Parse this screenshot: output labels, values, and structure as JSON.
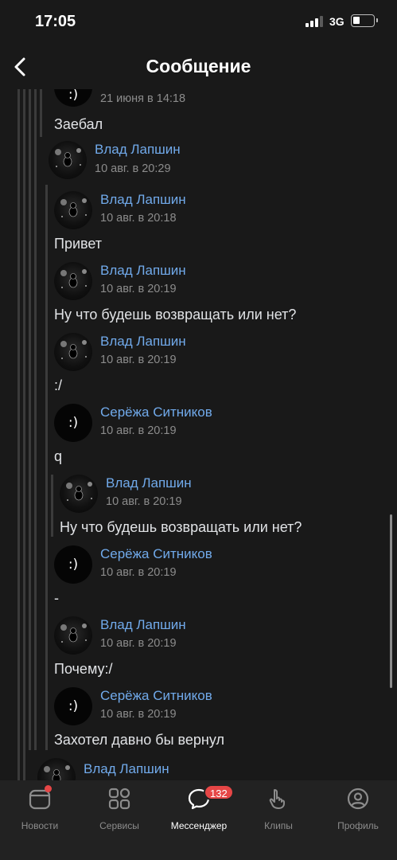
{
  "status_bar": {
    "time": "17:05",
    "network": "3G"
  },
  "header": {
    "title": "Сообщение"
  },
  "messages": [
    {
      "author": "",
      "time": "21 июня в 14:18",
      "text": "Заебал",
      "avatar": "smile-avatar"
    },
    {
      "author": "Влад Лапшин",
      "time": "10 авг. в 20:29",
      "text": "",
      "avatar": "space-avatar"
    },
    {
      "author": "Влад Лапшин",
      "time": "10 авг. в 20:18",
      "text": "Привет",
      "avatar": "space-avatar"
    },
    {
      "author": "Влад Лапшин",
      "time": "10 авг. в 20:19",
      "text": "Ну что будешь возвращать или нет?",
      "avatar": "space-avatar"
    },
    {
      "author": "Влад Лапшин",
      "time": "10 авг. в 20:19",
      "text": ":/",
      "avatar": "space-avatar"
    },
    {
      "author": "Серёжа Ситников",
      "time": "10 авг. в 20:19",
      "text": "q",
      "avatar": "smile-avatar",
      "avatar_text": ":)"
    },
    {
      "author": "Влад Лапшин",
      "time": "10 авг. в 20:19",
      "text": "Ну что будешь возвращать или нет?",
      "avatar": "space-avatar"
    },
    {
      "author": "Серёжа Ситников",
      "time": "10 авг. в 20:19",
      "text": "-",
      "avatar": "smile-avatar",
      "avatar_text": ":)"
    },
    {
      "author": "Влад Лапшин",
      "time": "10 авг. в 20:19",
      "text": "Почему:/",
      "avatar": "space-avatar"
    },
    {
      "author": "Серёжа Ситников",
      "time": "10 авг. в 20:19",
      "text": "Захотел давно бы вернул",
      "avatar": "smile-avatar",
      "avatar_text": ":)"
    },
    {
      "author": "Влад Лапшин",
      "time": "",
      "text": "",
      "avatar": "space-avatar"
    }
  ],
  "tabbar": {
    "tabs": [
      {
        "label": "Новости",
        "icon": "news-icon"
      },
      {
        "label": "Сервисы",
        "icon": "services-icon"
      },
      {
        "label": "Мессенджер",
        "icon": "messenger-icon",
        "badge": "132",
        "active": true
      },
      {
        "label": "Клипы",
        "icon": "clips-icon"
      },
      {
        "label": "Профиль",
        "icon": "profile-icon"
      }
    ]
  },
  "colors": {
    "background": "#191919",
    "link": "#71aaeb",
    "badge": "#e64646",
    "tabbar": "#222222"
  }
}
